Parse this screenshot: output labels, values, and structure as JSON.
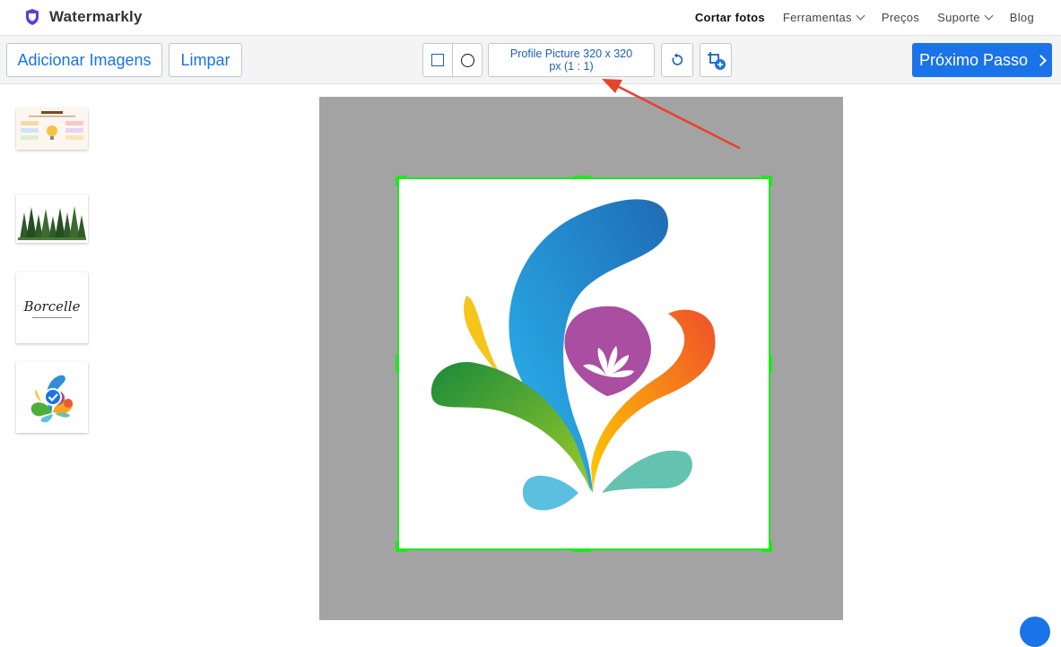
{
  "app": {
    "title": "Watermarkly"
  },
  "nav": {
    "items": [
      {
        "label": "Cortar fotos",
        "active": true,
        "dropdown": false
      },
      {
        "label": "Ferramentas",
        "active": false,
        "dropdown": true
      },
      {
        "label": "Preços",
        "active": false,
        "dropdown": false
      },
      {
        "label": "Suporte",
        "active": false,
        "dropdown": true
      },
      {
        "label": "Blog",
        "active": false,
        "dropdown": false
      }
    ]
  },
  "toolbar": {
    "add_images_label": "Adicionar Imagens",
    "clear_label": "Limpar",
    "preset_label": "Profile Picture 320 x 320 px (1 : 1)",
    "next_label": "Próximo Passo",
    "icons": {
      "rectangle": "square-shape-icon",
      "circle": "circle-shape-icon",
      "rotate": "rotate-icon",
      "add_crop": "add-crop-icon"
    }
  },
  "thumbnails": [
    {
      "name": "infographic-thumbnail"
    },
    {
      "name": "forest-thumbnail"
    },
    {
      "name": "borcelle-logo-thumbnail",
      "text": "Borcelle"
    },
    {
      "name": "splash-logo-thumbnail",
      "selected": true
    }
  ],
  "colors": {
    "accent": "#1a73e8",
    "crop_border": "#1ee81e",
    "canvas_bg": "#a3a3a3",
    "arrow": "#e8432c"
  }
}
